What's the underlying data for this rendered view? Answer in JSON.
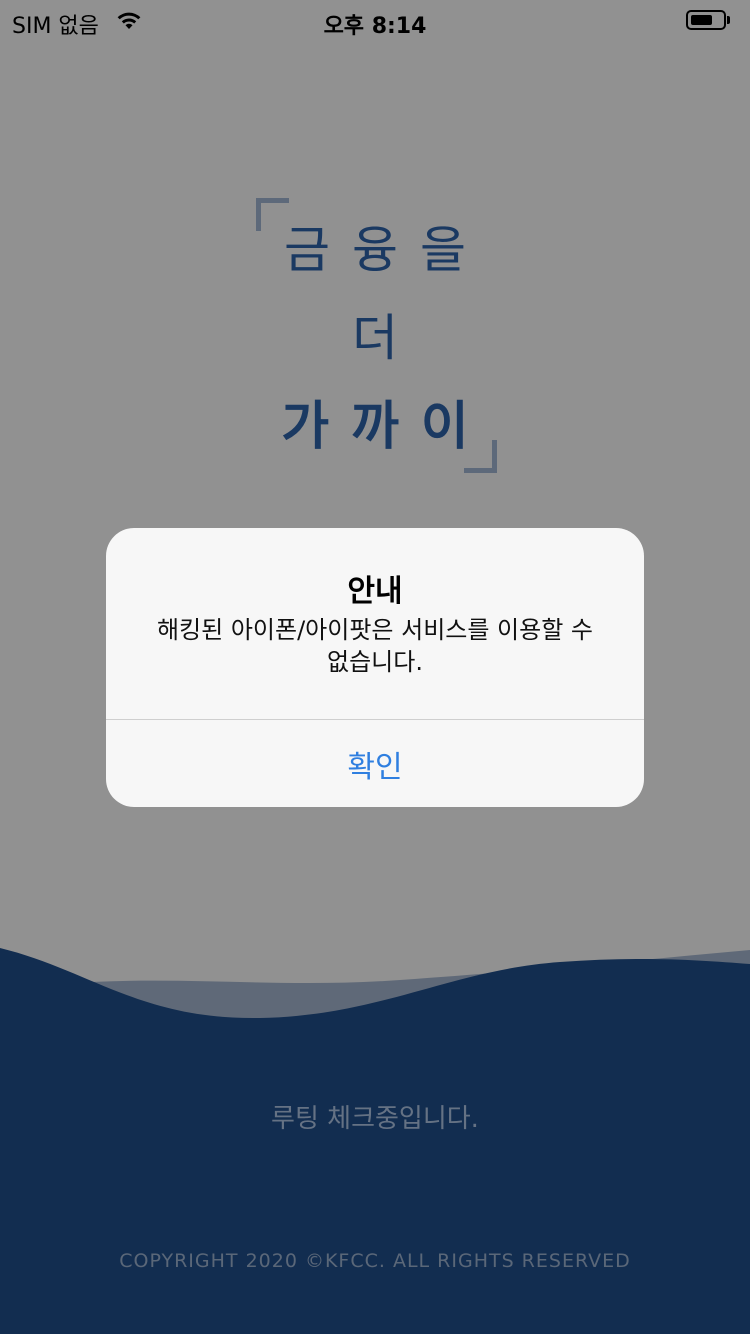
{
  "status_bar": {
    "carrier": "SIM 없음",
    "time": "오후 8:14",
    "icons": [
      "wifi-icon",
      "battery-icon"
    ]
  },
  "splash": {
    "slogan": [
      "금융을",
      "더",
      "가까이"
    ],
    "root_status": "루팅 체크중입니다.",
    "copyright": "COPYRIGHT 2020 ©KFCC. ALL RIGHTS RESERVED"
  },
  "alert": {
    "title": "안내",
    "message": "해킹된 아이폰/아이팟은 서비스를 이용할 수 없습니다.",
    "confirm_label": "확인"
  },
  "colors": {
    "brand_blue": "#1f4b86",
    "slogan_blue": "#2c5fa3",
    "alert_button": "#2f7fe0"
  }
}
